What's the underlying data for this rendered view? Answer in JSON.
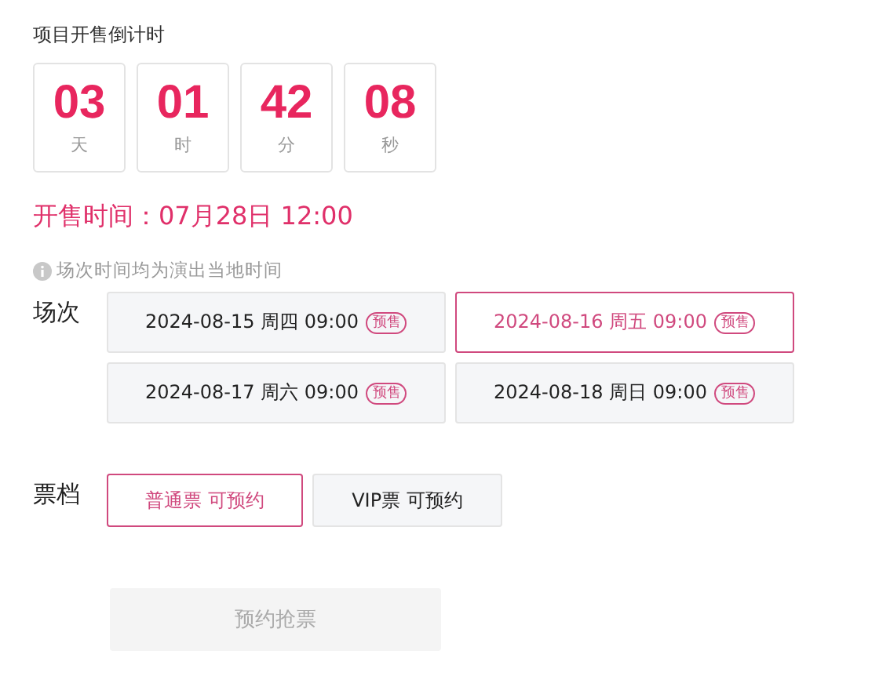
{
  "countdown": {
    "title": "项目开售倒计时",
    "units": [
      {
        "value": "03",
        "label": "天"
      },
      {
        "value": "01",
        "label": "时"
      },
      {
        "value": "42",
        "label": "分"
      },
      {
        "value": "08",
        "label": "秒"
      }
    ]
  },
  "sale_time": "开售时间：07月28日 12:00",
  "note": "场次时间均为演出当地时间",
  "sessions": {
    "label": "场次",
    "items": [
      {
        "text": "2024-08-15 周四 09:00",
        "badge": "预售",
        "selected": false
      },
      {
        "text": "2024-08-16 周五 09:00",
        "badge": "预售",
        "selected": true
      },
      {
        "text": "2024-08-17 周六 09:00",
        "badge": "预售",
        "selected": false
      },
      {
        "text": "2024-08-18 周日 09:00",
        "badge": "预售",
        "selected": false
      }
    ]
  },
  "tiers": {
    "label": "票档",
    "items": [
      {
        "text": "普通票 可预约",
        "selected": true
      },
      {
        "text": "VIP票 可预约",
        "selected": false
      }
    ]
  },
  "submit": {
    "label": "预约抢票",
    "disabled": true
  }
}
